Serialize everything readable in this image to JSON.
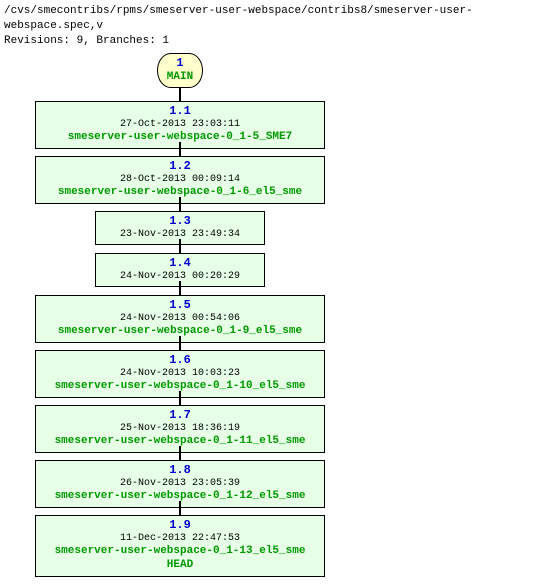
{
  "header": {
    "path": "/cvs/smecontribs/rpms/smeserver-user-webspace/contribs8/smeserver-user-webspace.spec,v",
    "stats": "Revisions: 9, Branches: 1"
  },
  "root": {
    "num": "1",
    "name": "MAIN"
  },
  "revisions": [
    {
      "ver": "1.1",
      "date": "27-Oct-2013 23:03:11",
      "tag": "smeserver-user-webspace-0_1-5_SME7"
    },
    {
      "ver": "1.2",
      "date": "28-Oct-2013 00:09:14",
      "tag": "smeserver-user-webspace-0_1-6_el5_sme"
    },
    {
      "ver": "1.3",
      "date": "23-Nov-2013 23:49:34",
      "tag": ""
    },
    {
      "ver": "1.4",
      "date": "24-Nov-2013 00:20:29",
      "tag": ""
    },
    {
      "ver": "1.5",
      "date": "24-Nov-2013 00:54:06",
      "tag": "smeserver-user-webspace-0_1-9_el5_sme"
    },
    {
      "ver": "1.6",
      "date": "24-Nov-2013 10:03:23",
      "tag": "smeserver-user-webspace-0_1-10_el5_sme"
    },
    {
      "ver": "1.7",
      "date": "25-Nov-2013 18:36:19",
      "tag": "smeserver-user-webspace-0_1-11_el5_sme"
    },
    {
      "ver": "1.8",
      "date": "26-Nov-2013 23:05:39",
      "tag": "smeserver-user-webspace-0_1-12_el5_sme"
    },
    {
      "ver": "1.9",
      "date": "11-Dec-2013 22:47:53",
      "tag": "smeserver-user-webspace-0_1-13_el5_sme",
      "extra": "HEAD"
    }
  ],
  "chart_data": {
    "type": "diagram",
    "title": "CVS revision tree",
    "branch": "MAIN",
    "nodes": [
      {
        "id": "1.1",
        "date": "27-Oct-2013 23:03:11",
        "tags": [
          "smeserver-user-webspace-0_1-5_SME7"
        ]
      },
      {
        "id": "1.2",
        "date": "28-Oct-2013 00:09:14",
        "tags": [
          "smeserver-user-webspace-0_1-6_el5_sme"
        ]
      },
      {
        "id": "1.3",
        "date": "23-Nov-2013 23:49:34",
        "tags": []
      },
      {
        "id": "1.4",
        "date": "24-Nov-2013 00:20:29",
        "tags": []
      },
      {
        "id": "1.5",
        "date": "24-Nov-2013 00:54:06",
        "tags": [
          "smeserver-user-webspace-0_1-9_el5_sme"
        ]
      },
      {
        "id": "1.6",
        "date": "24-Nov-2013 10:03:23",
        "tags": [
          "smeserver-user-webspace-0_1-10_el5_sme"
        ]
      },
      {
        "id": "1.7",
        "date": "25-Nov-2013 18:36:19",
        "tags": [
          "smeserver-user-webspace-0_1-11_el5_sme"
        ]
      },
      {
        "id": "1.8",
        "date": "26-Nov-2013 23:05:39",
        "tags": [
          "smeserver-user-webspace-0_1-12_el5_sme"
        ]
      },
      {
        "id": "1.9",
        "date": "11-Dec-2013 22:47:53",
        "tags": [
          "smeserver-user-webspace-0_1-13_el5_sme",
          "HEAD"
        ]
      }
    ],
    "edges_parent_to_child": [
      [
        "MAIN",
        "1.1"
      ],
      [
        "1.1",
        "1.2"
      ],
      [
        "1.2",
        "1.3"
      ],
      [
        "1.3",
        "1.4"
      ],
      [
        "1.4",
        "1.5"
      ],
      [
        "1.5",
        "1.6"
      ],
      [
        "1.6",
        "1.7"
      ],
      [
        "1.7",
        "1.8"
      ],
      [
        "1.8",
        "1.9"
      ]
    ]
  }
}
